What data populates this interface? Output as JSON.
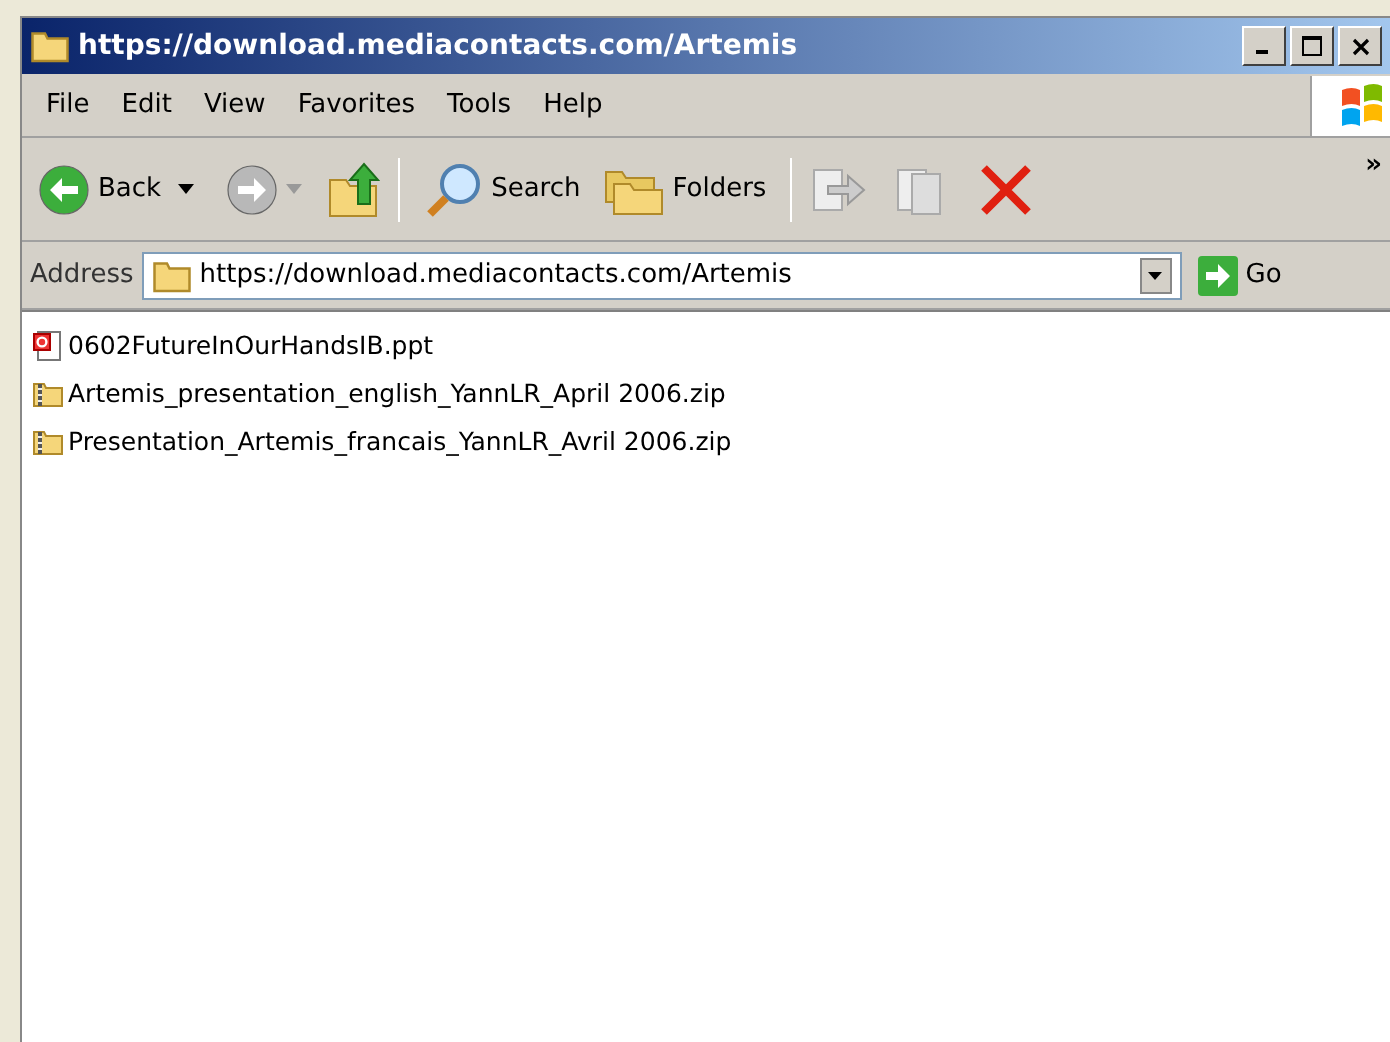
{
  "window": {
    "title": "https://download.mediacontacts.com/Artemis"
  },
  "menu": [
    "File",
    "Edit",
    "View",
    "Favorites",
    "Tools",
    "Help"
  ],
  "toolbar": {
    "back": "Back",
    "search": "Search",
    "folders": "Folders",
    "overflow": "»"
  },
  "address": {
    "label": "Address",
    "value": "https://download.mediacontacts.com/Artemis",
    "go": "Go"
  },
  "files": [
    {
      "name": "0602FutureInOurHandsIB.ppt",
      "kind": "ppt"
    },
    {
      "name": "Artemis_presentation_english_YannLR_April 2006.zip",
      "kind": "zip"
    },
    {
      "name": "Presentation_Artemis_francais_YannLR_Avril 2006.zip",
      "kind": "zip"
    }
  ]
}
